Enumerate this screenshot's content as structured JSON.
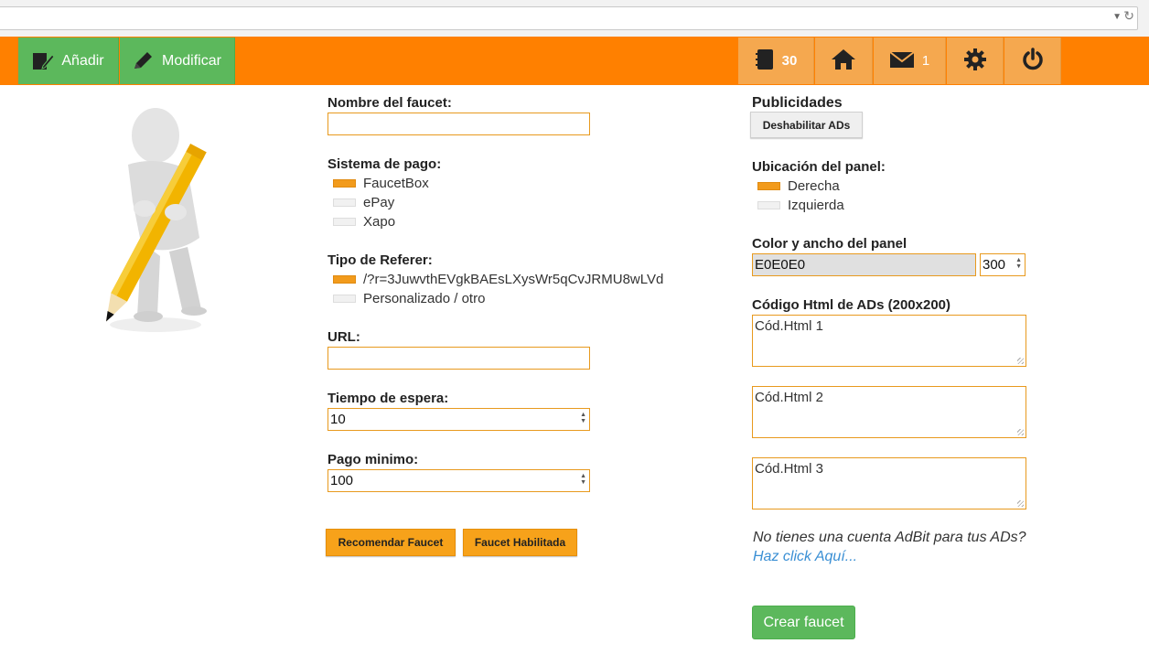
{
  "navbar": {
    "add_label": "Añadir",
    "edit_label": "Modificar",
    "book_count": "30",
    "mail_count": "1"
  },
  "form": {
    "faucet_name_label": "Nombre del faucet:",
    "faucet_name_value": "",
    "payment_system_label": "Sistema de pago:",
    "payment_options": [
      {
        "label": "FaucetBox",
        "selected": true
      },
      {
        "label": "ePay",
        "selected": false
      },
      {
        "label": "Xapo",
        "selected": false
      }
    ],
    "referer_label": "Tipo de Referer:",
    "referer_options": [
      {
        "label": "/?r=3JuwvthEVgkBAEsLXysWr5qCvJRMU8wLVd",
        "selected": true
      },
      {
        "label": "Personalizado / otro",
        "selected": false
      }
    ],
    "url_label": "URL:",
    "url_value": "",
    "wait_label": "Tiempo de espera:",
    "wait_value": "10",
    "min_pay_label": "Pago minimo:",
    "min_pay_value": "100",
    "recommend_button": "Recomendar Faucet",
    "enabled_button": "Faucet Habilitada"
  },
  "ads": {
    "title": "Publicidades",
    "disable_button": "Deshabilitar ADs",
    "panel_location_label": "Ubicación del panel:",
    "panel_location_options": [
      {
        "label": "Derecha",
        "selected": true
      },
      {
        "label": "Izquierda",
        "selected": false
      }
    ],
    "color_width_label": "Color y ancho del panel",
    "color_value": "E0E0E0",
    "width_value": "300",
    "html_code_label": "Código Html de ADs (200x200)",
    "html_code_1": "Cód.Html 1",
    "html_code_2": "Cód.Html 2",
    "html_code_3": "Cód.Html 3",
    "adbit_note": "No tienes una cuenta AdBit para tus ADs?",
    "adbit_link": "Haz click Aquí...",
    "create_button": "Crear faucet"
  },
  "colors": {
    "navbar": "#ff8000",
    "green": "#5cb85c",
    "orange_button": "#f7a21a",
    "link": "#3a8fd4",
    "panel_color": "#E0E0E0"
  }
}
